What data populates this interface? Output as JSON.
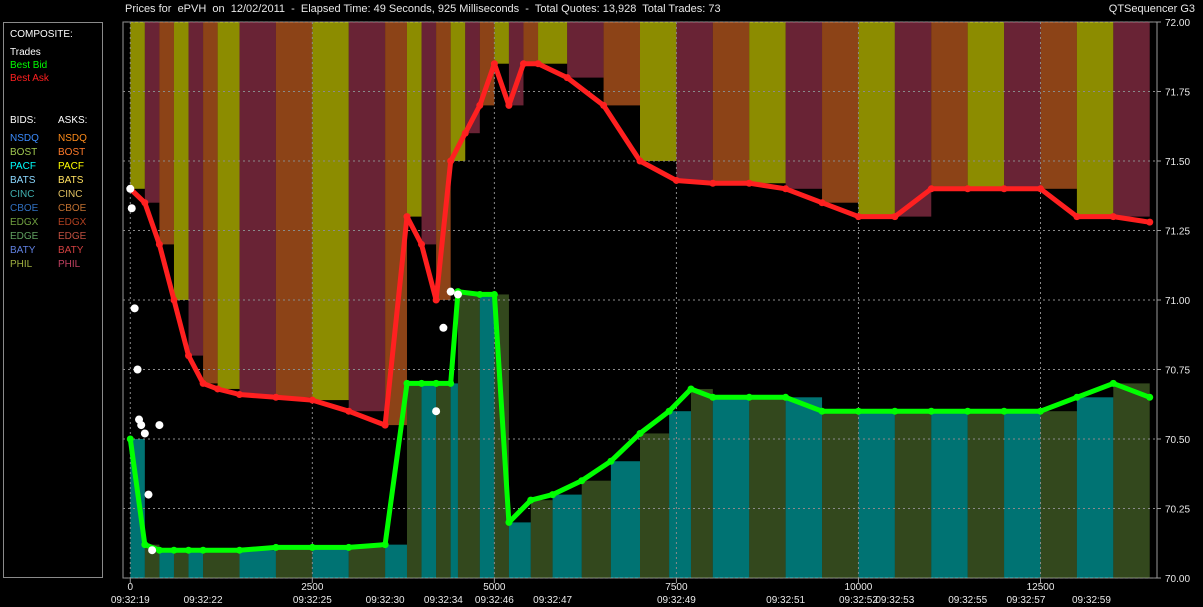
{
  "header": {
    "title": "Prices for  ePVH  on  12/02/2011  -  Elapsed Time: 49 Seconds, 925 Milliseconds  -  Total Quotes: 13,928  Total Trades: 73",
    "app_name": "QTSequencer G3"
  },
  "legend": {
    "composite_label": "COMPOSITE:",
    "composite_items": [
      {
        "label": "Trades",
        "color": "#ffffff"
      },
      {
        "label": "Best Bid",
        "color": "#00ff00"
      },
      {
        "label": "Best Ask",
        "color": "#ff2020"
      }
    ],
    "bids_label": "BIDS:",
    "asks_label": "ASKS:",
    "venues": [
      {
        "bid": "NSDQ",
        "ask": "NSDQ",
        "bid_color": "#3a8cff",
        "ask_color": "#ff8c1a"
      },
      {
        "bid": "BOST",
        "ask": "BOST",
        "bid_color": "#a0c850",
        "ask_color": "#ff7a2a"
      },
      {
        "bid": "PACF",
        "ask": "PACF",
        "bid_color": "#00ffff",
        "ask_color": "#ffff00"
      },
      {
        "bid": "BATS",
        "ask": "BATS",
        "bid_color": "#8cd8ff",
        "ask_color": "#ffe060"
      },
      {
        "bid": "CINC",
        "ask": "CINC",
        "bid_color": "#40b0b0",
        "ask_color": "#e0c060"
      },
      {
        "bid": "CBOE",
        "ask": "CBOE",
        "bid_color": "#3070c0",
        "ask_color": "#c07030"
      },
      {
        "bid": "EDGX",
        "ask": "EDGX",
        "bid_color": "#70a040",
        "ask_color": "#b04020"
      },
      {
        "bid": "EDGE",
        "ask": "EDGE",
        "bid_color": "#60a060",
        "ask_color": "#c05040"
      },
      {
        "bid": "BATY",
        "ask": "BATY",
        "bid_color": "#6080e0",
        "ask_color": "#d04040"
      },
      {
        "bid": "PHIL",
        "ask": "PHIL",
        "bid_color": "#a0b040",
        "ask_color": "#c04060"
      }
    ]
  },
  "chart_data": {
    "type": "line",
    "ylim": [
      70.0,
      72.0
    ],
    "yticks": [
      "72.00",
      "71.75",
      "71.50",
      "71.25",
      "71.00",
      "70.75",
      "70.50",
      "70.25",
      "70.00"
    ],
    "xlim": [
      -100,
      14100
    ],
    "xticks": [
      0,
      2500,
      5000,
      7500,
      10000,
      12500
    ],
    "xtick_labels": [
      "0",
      "2500",
      "5000",
      "7500",
      "10000",
      "12500"
    ],
    "time_labels": [
      {
        "x": 0,
        "label": "09:32:19"
      },
      {
        "x": 1000,
        "label": "09:32:22"
      },
      {
        "x": 2500,
        "label": "09:32:25"
      },
      {
        "x": 3500,
        "label": "09:32:30"
      },
      {
        "x": 4300,
        "label": "09:32:34"
      },
      {
        "x": 5000,
        "label": "09:32:46"
      },
      {
        "x": 5800,
        "label": "09:32:47"
      },
      {
        "x": 7500,
        "label": "09:32:49"
      },
      {
        "x": 9000,
        "label": "09:32:51"
      },
      {
        "x": 10000,
        "label": "09:32:52"
      },
      {
        "x": 10500,
        "label": "09:32:53"
      },
      {
        "x": 11500,
        "label": "09:32:55"
      },
      {
        "x": 12300,
        "label": "09:32:57"
      },
      {
        "x": 13200,
        "label": "09:32:59"
      }
    ],
    "series": [
      {
        "name": "Best Ask",
        "color": "#ff2020",
        "x": [
          0,
          200,
          400,
          600,
          800,
          1000,
          1200,
          1500,
          2000,
          2500,
          3000,
          3500,
          3800,
          4000,
          4200,
          4400,
          4600,
          4800,
          5000,
          5200,
          5400,
          5600,
          6000,
          6500,
          7000,
          7500,
          8000,
          8500,
          9000,
          9500,
          10000,
          10500,
          11000,
          11500,
          12000,
          12500,
          13000,
          13500,
          14000
        ],
        "y": [
          71.4,
          71.35,
          71.2,
          71.0,
          70.8,
          70.7,
          70.68,
          70.66,
          70.65,
          70.64,
          70.6,
          70.55,
          71.3,
          71.2,
          71.0,
          71.5,
          71.6,
          71.7,
          71.85,
          71.7,
          71.85,
          71.85,
          71.8,
          71.7,
          71.5,
          71.43,
          71.42,
          71.42,
          71.4,
          71.35,
          71.3,
          71.3,
          71.4,
          71.4,
          71.4,
          71.4,
          71.3,
          71.3,
          71.28
        ]
      },
      {
        "name": "Best Bid",
        "color": "#00ff00",
        "x": [
          0,
          200,
          400,
          600,
          800,
          1000,
          1500,
          2000,
          2500,
          3000,
          3500,
          3800,
          4000,
          4200,
          4400,
          4500,
          4800,
          5000,
          5200,
          5500,
          5800,
          6200,
          6600,
          7000,
          7400,
          7700,
          8000,
          8500,
          9000,
          9500,
          10000,
          10500,
          11000,
          11500,
          12000,
          12500,
          13000,
          13500,
          14000
        ],
        "y": [
          70.5,
          70.12,
          70.1,
          70.1,
          70.1,
          70.1,
          70.1,
          70.11,
          70.11,
          70.11,
          70.12,
          70.7,
          70.7,
          70.7,
          70.7,
          71.03,
          71.02,
          71.02,
          70.2,
          70.28,
          70.3,
          70.35,
          70.42,
          70.52,
          70.6,
          70.68,
          70.65,
          70.65,
          70.65,
          70.6,
          70.6,
          70.6,
          70.6,
          70.6,
          70.6,
          70.6,
          70.65,
          70.7,
          70.65
        ]
      },
      {
        "name": "Trades",
        "color": "#ffffff",
        "x": [
          0,
          20,
          60,
          100,
          120,
          150,
          200,
          250,
          300,
          400,
          4200,
          4300,
          4400,
          4500
        ],
        "y": [
          71.4,
          71.33,
          70.97,
          70.75,
          70.57,
          70.55,
          70.52,
          70.3,
          70.1,
          70.55,
          70.6,
          70.9,
          71.03,
          71.02
        ]
      }
    ]
  }
}
